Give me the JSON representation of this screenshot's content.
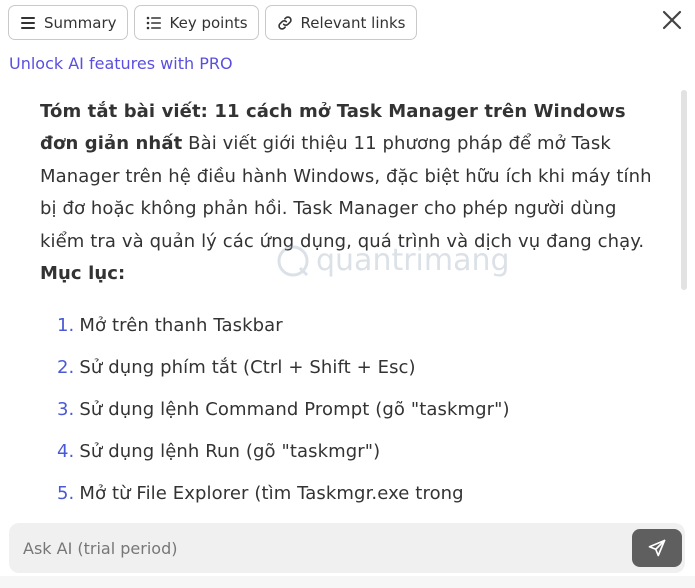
{
  "tabs": [
    {
      "label": "Summary",
      "icon": "menu-icon"
    },
    {
      "label": "Key points",
      "icon": "list-icon"
    },
    {
      "label": "Relevant links",
      "icon": "link-icon"
    }
  ],
  "promo_link": "Unlock AI features with PRO",
  "article": {
    "title_bold": "Tóm tắt bài viết: 11 cách mở Task Manager trên Windows đơn giản nhất",
    "summary": " Bài viết giới thiệu 11 phương pháp để mở Task Manager trên hệ điều hành Windows, đặc biệt hữu ích khi máy tính bị đơ hoặc không phản hồi. Task Manager cho phép người dùng kiểm tra và quản lý các ứng dụng, quá trình và dịch vụ đang chạy. ",
    "toc_heading": "Mục lục:",
    "toc": [
      {
        "num": "1.",
        "text": "Mở trên thanh Taskbar"
      },
      {
        "num": "2.",
        "text": "Sử dụng phím tắt (Ctrl + Shift + Esc)"
      },
      {
        "num": "3.",
        "text": "Sử dụng lệnh Command Prompt (gõ \"taskmgr\")"
      },
      {
        "num": "4.",
        "text": "Sử dụng lệnh Run (gõ \"taskmgr\")"
      },
      {
        "num": "5.",
        "text": "Mở từ File Explorer (tìm Taskmgr.exe trong"
      }
    ]
  },
  "watermark": "quantrimang",
  "ask": {
    "placeholder": "Ask AI (trial period)"
  },
  "colors": {
    "accent": "#5a4fe0",
    "send_button": "#5f5f5f",
    "input_bg": "#f0f0f1"
  }
}
